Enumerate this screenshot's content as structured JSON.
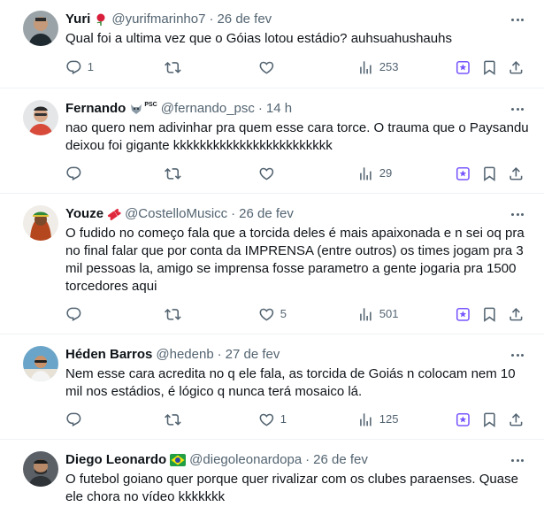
{
  "colors": {
    "text": "#0f1419",
    "secondary": "#536471",
    "grok_purple": "#7856ff",
    "divider": "#eff3f4"
  },
  "tweets": [
    {
      "name": "Yuri",
      "badge_icon": "rose-emoji-icon",
      "handle": "@yurifmarinho7",
      "separator": "·",
      "time": "26 de fev",
      "text": "Qual foi a ultima vez que o Góias lotou estádio? auhsuahushauhs",
      "replies": "1",
      "retweets": "",
      "likes": "",
      "views": "253"
    },
    {
      "name": "Fernando",
      "badge_icon": "wolf-psc-emoji-icon",
      "badge_text": "PSC",
      "handle": "@fernando_psc",
      "separator": "·",
      "time": "14 h",
      "text": "nao quero nem adivinhar pra quem esse cara torce. O trauma que o Paysandu deixou foi gigante kkkkkkkkkkkkkkkkkkkkkkkk",
      "replies": "",
      "retweets": "",
      "likes": "",
      "views": "29"
    },
    {
      "name": "Youze",
      "badge_icon": "ticket-emoji-icon",
      "handle": "@CostelloMusicc",
      "separator": "·",
      "time": "26 de fev",
      "text": "O fudido no começo fala que a torcida deles é mais apaixonada e n sei oq pra no final falar que por conta da IMPRENSA (entre outros) os times jogam pra 3 mil pessoas la, amigo se imprensa fosse parametro a gente jogaria pra 1500 torcedores aqui",
      "replies": "",
      "retweets": "",
      "likes": "5",
      "views": "501"
    },
    {
      "name": "Héden Barros",
      "handle": "@hedenb",
      "separator": "·",
      "time": "27 de fev",
      "text": "Nem esse cara acredita no q ele fala, as torcida de Goiás n colocam nem 10 mil nos estádios, é lógico q nunca terá mosaico lá.",
      "replies": "",
      "retweets": "",
      "likes": "1",
      "views": "125"
    },
    {
      "name": "Diego Leonardo",
      "badge_icon": "brazil-flag-emoji-icon",
      "handle": "@diegoleonardopa",
      "separator": "·",
      "time": "26 de fev",
      "text": "O futebol goiano quer porque quer rivalizar com os clubes paraenses. Quase ele chora no vídeo kkkkkkk"
    }
  ]
}
